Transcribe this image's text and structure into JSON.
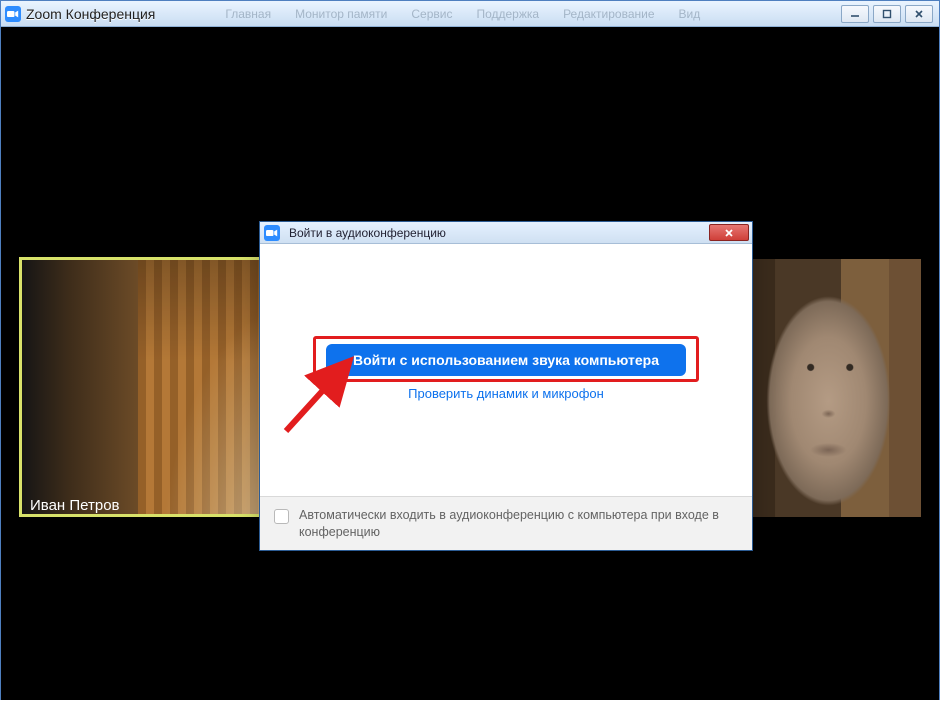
{
  "window": {
    "title": "Zoom Конференция",
    "menu_hints": [
      "Главная",
      "Монитор памяти",
      "Сервис",
      "Поддержка",
      "Редактирование",
      "Вид"
    ]
  },
  "participants": {
    "left_name": "Иван Петров"
  },
  "modal": {
    "title": "Войти в аудиоконференцию",
    "join_button": "Войти с использованием звука компьютера",
    "test_link": "Проверить динамик и микрофон",
    "auto_join_label": "Автоматически входить в аудиоконференцию с компьютера при входе в конференцию"
  }
}
